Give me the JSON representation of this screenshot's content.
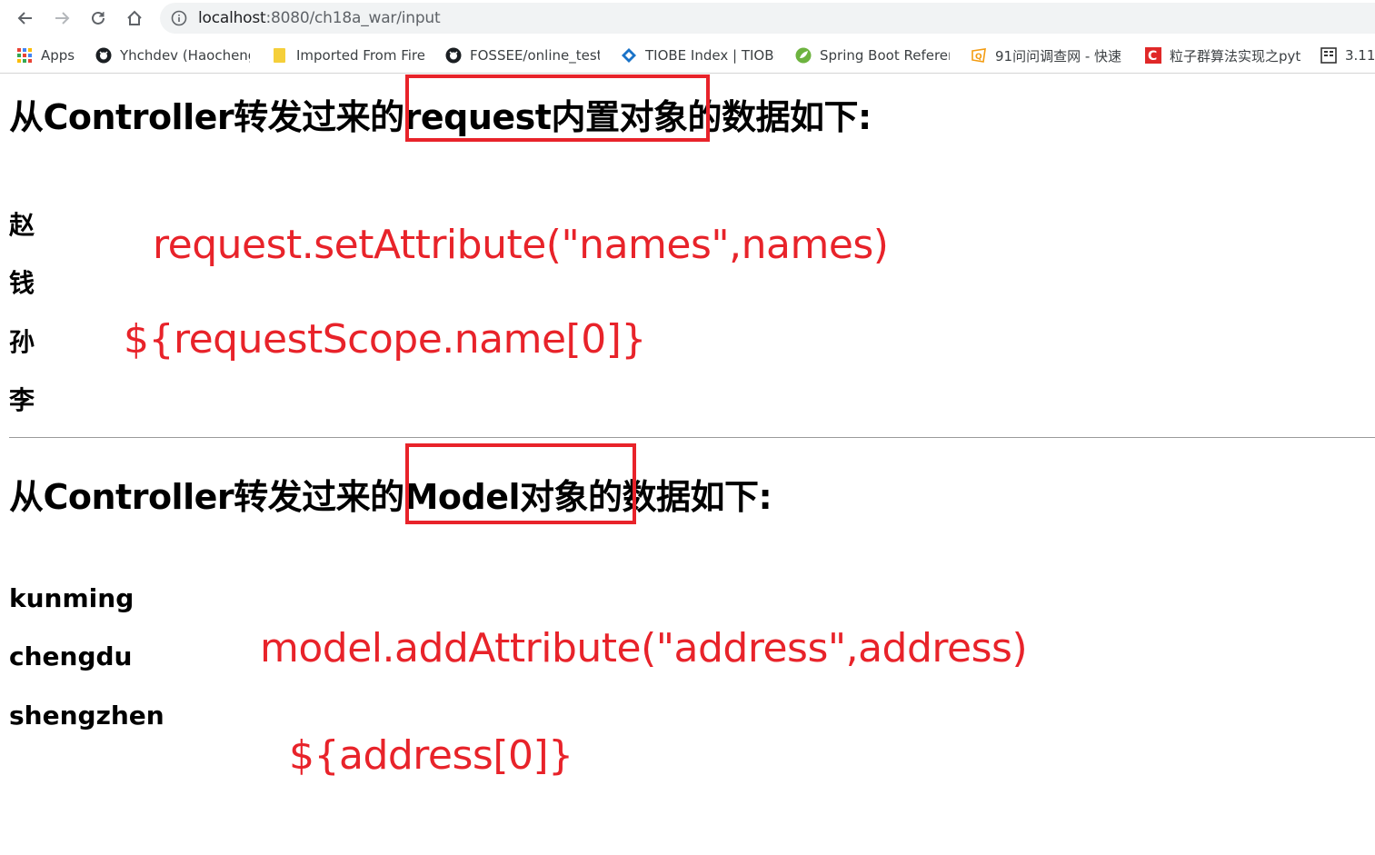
{
  "browser": {
    "url_host": "localhost",
    "url_rest": ":8080/ch18a_war/input",
    "bookmarks": [
      {
        "label": "Apps",
        "icon": "apps-grid-icon"
      },
      {
        "label": "Yhchdev (Haocheng",
        "icon": "github-icon"
      },
      {
        "label": "Imported From Fire",
        "icon": "folder-icon"
      },
      {
        "label": "FOSSEE/online_test",
        "icon": "github-icon"
      },
      {
        "label": "TIOBE Index | TIOBE",
        "icon": "tiobe-icon"
      },
      {
        "label": "Spring Boot Referen",
        "icon": "spring-icon"
      },
      {
        "label": "91问问调查网 - 快速",
        "icon": "wenjuan-icon"
      },
      {
        "label": "粒子群算法实现之pyt",
        "icon": "csdn-icon"
      },
      {
        "label": "3.11",
        "icon": "book-icon"
      }
    ]
  },
  "section1": {
    "heading": "从Controller转发过来的request内置对象的数据如下:",
    "items": [
      "赵",
      "钱",
      "孙",
      "李"
    ],
    "annotation1": "request.setAttribute(\"names\",names)",
    "annotation2": "${requestScope.name[0]}"
  },
  "section2": {
    "heading": "从Controller转发过来的Model对象的数据如下:",
    "items": [
      "kunming",
      "chengdu",
      "shengzhen"
    ],
    "annotation1": "model.addAttribute(\"address\",address)",
    "annotation2": "${address[0]}"
  },
  "colors": {
    "annotation_red": "#e8232a",
    "omnibox_bg": "#f1f3f4"
  }
}
